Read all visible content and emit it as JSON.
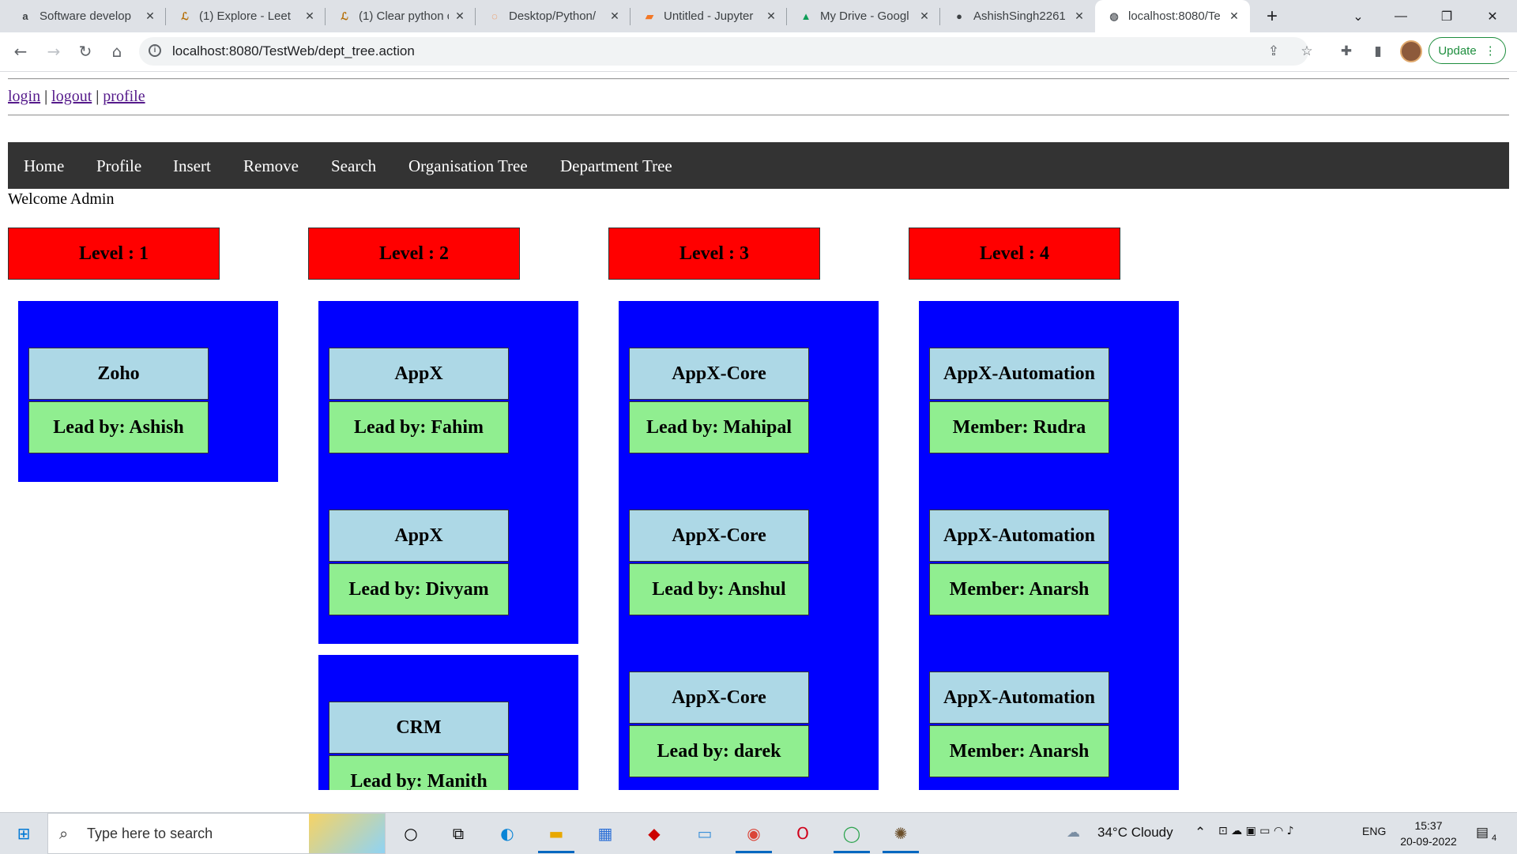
{
  "browser": {
    "tabs": [
      {
        "title": "Software develop",
        "icon": "amazon-icon"
      },
      {
        "title": "(1) Explore - Leet",
        "icon": "leetcode-icon"
      },
      {
        "title": "(1) Clear python c",
        "icon": "leetcode-icon"
      },
      {
        "title": "Desktop/Python/",
        "icon": "jupyter-icon"
      },
      {
        "title": "Untitled - Jupyter",
        "icon": "jupyter-notebook-icon"
      },
      {
        "title": "My Drive - Googl",
        "icon": "google-drive-icon"
      },
      {
        "title": "AshishSingh2261",
        "icon": "github-icon"
      },
      {
        "title": "localhost:8080/Te",
        "icon": "globe-icon"
      }
    ],
    "url": "localhost:8080/TestWeb/dept_tree.action",
    "update_label": "Update"
  },
  "page": {
    "links": {
      "login": "login",
      "logout": "logout",
      "profile": "profile",
      "separator": "|"
    },
    "nav": [
      "Home",
      "Profile",
      "Insert",
      "Remove",
      "Search",
      "Organisation Tree",
      "Department Tree"
    ],
    "welcome": "Welcome Admin",
    "levels": [
      {
        "label": "Level : 1",
        "groups": [
          [
            {
              "name": "Zoho",
              "lead": "Lead by: Ashish"
            }
          ]
        ]
      },
      {
        "label": "Level : 2",
        "groups": [
          [
            {
              "name": "AppX",
              "lead": "Lead by: Fahim"
            },
            {
              "name": "AppX",
              "lead": "Lead by: Divyam"
            }
          ],
          [
            {
              "name": "CRM",
              "lead": "Lead by: Manith"
            }
          ]
        ]
      },
      {
        "label": "Level : 3",
        "groups": [
          [
            {
              "name": "AppX-Core",
              "lead": "Lead by: Mahipal"
            },
            {
              "name": "AppX-Core",
              "lead": "Lead by: Anshul"
            },
            {
              "name": "AppX-Core",
              "lead": "Lead by: darek"
            }
          ]
        ]
      },
      {
        "label": "Level : 4",
        "groups": [
          [
            {
              "name": "AppX-Automation",
              "lead": "Member: Rudra"
            },
            {
              "name": "AppX-Automation",
              "lead": "Member: Anarsh"
            },
            {
              "name": "AppX-Automation",
              "lead": "Member: Anarsh"
            }
          ]
        ]
      }
    ]
  },
  "taskbar": {
    "search_placeholder": "Type here to search",
    "weather": "34°C  Cloudy",
    "language": "ENG",
    "time": "15:37",
    "date": "20-09-2022",
    "notification_count": "4"
  },
  "colors": {
    "level_header": "#ff0000",
    "group_bg": "#0000ff",
    "node_name_bg": "#add8e6",
    "node_lead_bg": "#90ee90",
    "navbar_bg": "#333333"
  }
}
